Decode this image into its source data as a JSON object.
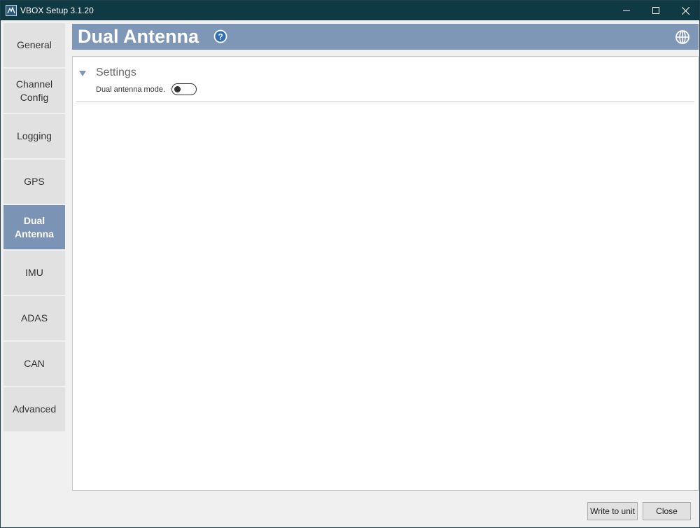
{
  "window": {
    "title": "VBOX Setup 3.1.20"
  },
  "sidebar": {
    "items": [
      {
        "label": "General"
      },
      {
        "label": "Channel\nConfig"
      },
      {
        "label": "Logging"
      },
      {
        "label": "GPS"
      },
      {
        "label": "Dual\nAntenna",
        "active": true
      },
      {
        "label": "IMU"
      },
      {
        "label": "ADAS"
      },
      {
        "label": "CAN"
      },
      {
        "label": "Advanced"
      }
    ]
  },
  "header": {
    "title": "Dual Antenna",
    "icons": [
      "help-icon",
      "globe-icon"
    ]
  },
  "settings": {
    "section_title": "Settings",
    "dual_antenna_mode_label": "Dual antenna mode.",
    "dual_antenna_mode_on": false
  },
  "footer": {
    "write_label": "Write to unit",
    "close_label": "Close"
  },
  "colors": {
    "titlebar": "#0f3a44",
    "accent": "#7f97b6",
    "active_nav": "#7b93b4"
  }
}
